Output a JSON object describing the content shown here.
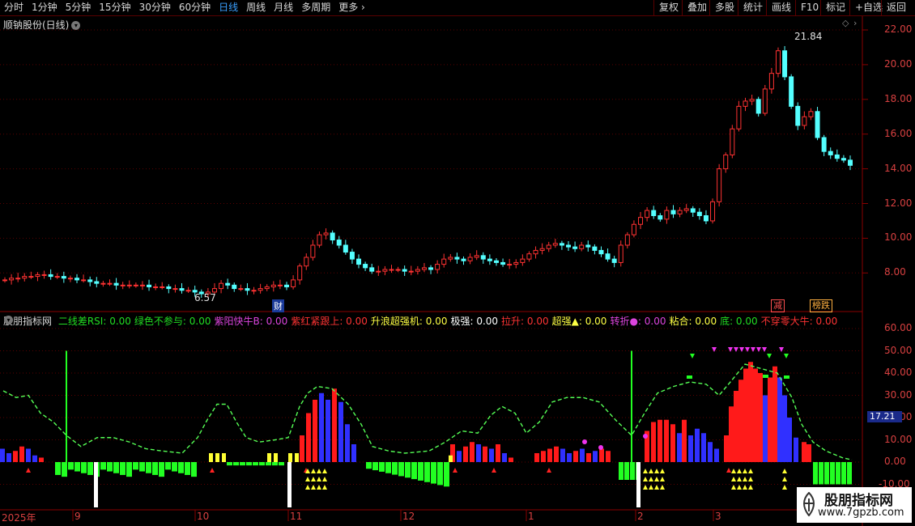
{
  "toolbar": {
    "timeframes": [
      "分时",
      "1分钟",
      "5分钟",
      "15分钟",
      "30分钟",
      "60分钟",
      "日线",
      "周线",
      "月线",
      "多周期",
      "更多"
    ],
    "active_timeframe": "日线",
    "right_buttons": [
      "复权",
      "叠加",
      "多股",
      "统计",
      "画线",
      "F10",
      "标记",
      "+自选",
      "返回"
    ]
  },
  "stock": {
    "title": "顺钠股份(日线)",
    "high_label": "21.84",
    "low_label": "6.57",
    "marker_cai": "财",
    "tag1": "减",
    "tag2": "榜跌"
  },
  "price_axis": [
    "22.00",
    "20.00",
    "18.00",
    "16.00",
    "14.00",
    "12.00",
    "10.00",
    "8.00"
  ],
  "indicator": {
    "name": "股朋指标网",
    "items": [
      {
        "label": "二线差RSI: 0.00",
        "color": "#22dd22"
      },
      {
        "label": "绿色不参与: 0.00",
        "color": "#22dd22"
      },
      {
        "label": "紫阳快牛B: 0.00",
        "color": "#dd44dd"
      },
      {
        "label": "紫红紧跟上: 0.00",
        "color": "#ff3333"
      },
      {
        "label": "升浪超强机: 0.00",
        "color": "#ffff44"
      },
      {
        "label": "极强: 0.00",
        "color": "#ffffff"
      },
      {
        "label": "拉升: 0.00",
        "color": "#ff3333"
      },
      {
        "label": "超强▲: 0.00",
        "color": "#ffff44"
      },
      {
        "label": "转折●: 0.00",
        "color": "#dd44dd"
      },
      {
        "label": "粘合: 0.00",
        "color": "#ffff44"
      },
      {
        "label": "底: 0.00",
        "color": "#22dd22"
      },
      {
        "label": "不穿零大牛: 0.00",
        "color": "#ff3333"
      }
    ],
    "axis": [
      "60.00",
      "50.00",
      "40.00",
      "30.00",
      "20.00",
      "10.00",
      "0.00",
      "-10.00"
    ],
    "last_value": "17.21"
  },
  "x_axis": [
    "2025年",
    "9",
    "10",
    "11",
    "12",
    "1",
    "2",
    "3"
  ],
  "watermark": {
    "title": "股朋指标网",
    "url": "www.7gpzb.com"
  },
  "colors": {
    "up": "#ff3232",
    "down": "#54ffff",
    "red": "#ff1a1a",
    "blue": "#3030ff",
    "green": "#22ff22",
    "yellow": "#ffff33"
  }
}
